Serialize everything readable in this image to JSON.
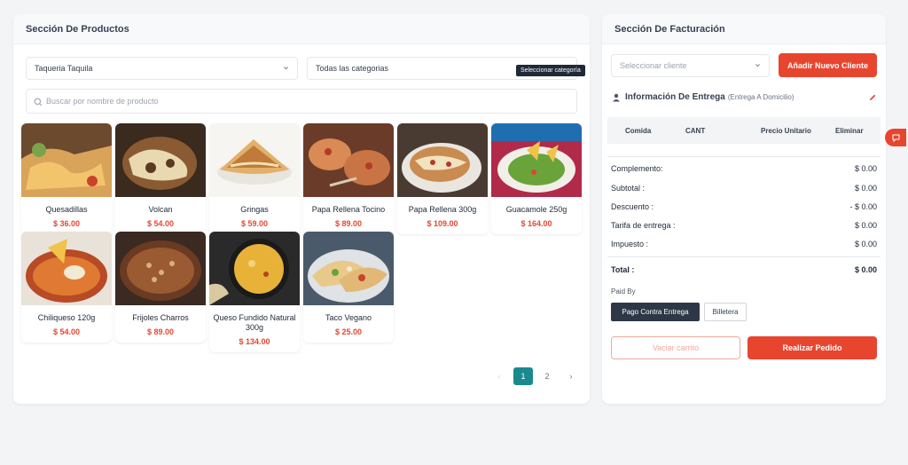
{
  "products_panel": {
    "title": "Sección De Productos",
    "store_select": "Taqueria Taquila",
    "category_select": "Todas las categorias",
    "category_tooltip": "Seleccionar categoría",
    "search_placeholder": "Buscar por nombre de producto",
    "products": [
      {
        "name": "Quesadillas",
        "price": "$ 36.00"
      },
      {
        "name": "Volcan",
        "price": "$ 54.00"
      },
      {
        "name": "Gringas",
        "price": "$ 59.00"
      },
      {
        "name": "Papa Rellena Tocino",
        "price": "$ 89.00"
      },
      {
        "name": "Papa Rellena 300g",
        "price": "$ 109.00"
      },
      {
        "name": "Guacamole 250g",
        "price": "$ 164.00"
      },
      {
        "name": "Chiliqueso 120g",
        "price": "$ 54.00"
      },
      {
        "name": "Frijoles Charros",
        "price": "$ 89.00"
      },
      {
        "name": "Queso Fundido Natural 300g",
        "price": "$ 134.00"
      },
      {
        "name": "Taco Vegano",
        "price": "$ 25.00"
      }
    ],
    "pagination": {
      "prev": "‹",
      "pages": [
        "1",
        "2"
      ],
      "next": "›",
      "current": "1"
    }
  },
  "billing_panel": {
    "title": "Sección De Facturación",
    "client_placeholder": "Seleccionar cliente",
    "add_client_label": "Añadir Nuevo Cliente",
    "delivery_title": "Información De Entrega",
    "delivery_mode": "(Entrega A Domicilio)",
    "table_headers": [
      "Comida",
      "CANT",
      "Precio Unitario",
      "Eliminar"
    ],
    "summary": [
      {
        "label": "Complemento:",
        "value": "$ 0.00"
      },
      {
        "label": "Subtotal :",
        "value": "$ 0.00"
      },
      {
        "label": "Descuento :",
        "value": "- $ 0.00"
      },
      {
        "label": "Tarifa de entrega :",
        "value": "$ 0.00"
      },
      {
        "label": "Impuesto :",
        "value": "$ 0.00"
      }
    ],
    "total_label": "Total :",
    "total_value": "$ 0.00",
    "paid_by_label": "Paid By",
    "payment_options": [
      "Pago Contra Entrega",
      "Billetera"
    ],
    "selected_payment": "Pago Contra Entrega",
    "empty_cart_label": "Vaciar carrito",
    "place_order_label": "Realizar Pedido"
  },
  "colors": {
    "accent": "#e8452f",
    "teal": "#1b8a8f",
    "dark": "#2d3748"
  }
}
